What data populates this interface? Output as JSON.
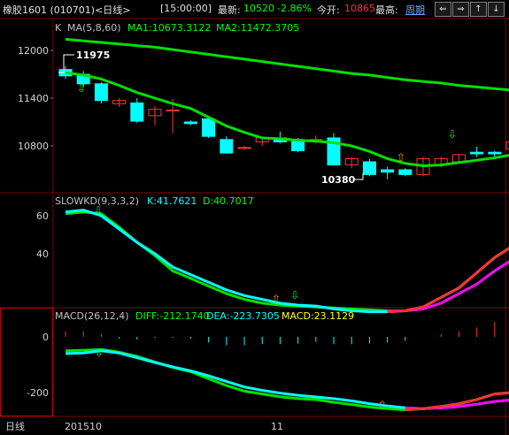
{
  "header": {
    "instrument": "橡胶1601 (010701)<日线>",
    "time": "[15:00:00]",
    "last_label": "最新:",
    "last_value": "10520",
    "change": "-2.86%",
    "open_label": "今开:",
    "open_value": "10865",
    "high_label": "最高:",
    "period_link": "周期",
    "nav_icons": [
      "prev-icon",
      "next-icon",
      "zoom-in-icon",
      "zoom-out-icon"
    ]
  },
  "price_panel": {
    "title_k": "K",
    "ma_label": "MA(5,8,60)",
    "ma1_text": "MA1:10673.3122",
    "ma2_text": "MA2:11472.3705",
    "y_ticks": [
      "12000",
      "11400",
      "10800"
    ],
    "high_annotation": "11975",
    "low_annotation": "10380"
  },
  "kd_panel": {
    "title": "SLOWKD(9,3,3,2)",
    "k_text": "K:41.7621",
    "d_text": "D:40.7017",
    "y_ticks": [
      "60",
      "40"
    ]
  },
  "macd_panel": {
    "title": "MACD(26,12,4)",
    "diff_text": "DIFF:-212.1740",
    "dea_text": "DEA:-223.7305",
    "macd_text": "MACD:23.1129",
    "y_ticks": [
      "0",
      "-200"
    ]
  },
  "footer": {
    "period": "日线",
    "date_start": "201510",
    "month_mark": "11"
  },
  "colors": {
    "up": "#ff3232",
    "down": "#00ffff",
    "ma1": "#00e000",
    "ma2": "#00e000",
    "frame": "#800000",
    "k_line": "#00ffff",
    "d_line": "#00e000",
    "label_yellow": "#ffff00",
    "label_green": "#00ff00",
    "label_magenta": "#ff00ff"
  },
  "chart_data": {
    "type": "candlestick",
    "candles": [
      {
        "o": 11760,
        "h": 11800,
        "l": 11640,
        "c": 11680
      },
      {
        "o": 11700,
        "h": 11740,
        "l": 11540,
        "c": 11580
      },
      {
        "o": 11580,
        "h": 11600,
        "l": 11330,
        "c": 11370
      },
      {
        "o": 11330,
        "h": 11400,
        "l": 11290,
        "c": 11370
      },
      {
        "o": 11340,
        "h": 11400,
        "l": 11090,
        "c": 11110
      },
      {
        "o": 11180,
        "h": 11300,
        "l": 11060,
        "c": 11260
      },
      {
        "o": 11250,
        "h": 11390,
        "l": 10960,
        "c": 11250
      },
      {
        "o": 11100,
        "h": 11120,
        "l": 11060,
        "c": 11080
      },
      {
        "o": 11140,
        "h": 11180,
        "l": 10900,
        "c": 10920
      },
      {
        "o": 10880,
        "h": 10920,
        "l": 10700,
        "c": 10710
      },
      {
        "o": 10780,
        "h": 10800,
        "l": 10750,
        "c": 10780
      },
      {
        "o": 10850,
        "h": 10920,
        "l": 10800,
        "c": 10900
      },
      {
        "o": 10900,
        "h": 10980,
        "l": 10830,
        "c": 10850
      },
      {
        "o": 10880,
        "h": 10900,
        "l": 10720,
        "c": 10740
      },
      {
        "o": 10860,
        "h": 10930,
        "l": 10830,
        "c": 10880
      },
      {
        "o": 10900,
        "h": 10960,
        "l": 10550,
        "c": 10560
      },
      {
        "o": 10560,
        "h": 10660,
        "l": 10520,
        "c": 10640
      },
      {
        "o": 10600,
        "h": 10640,
        "l": 10420,
        "c": 10440
      },
      {
        "o": 10500,
        "h": 10540,
        "l": 10380,
        "c": 10470
      },
      {
        "o": 10500,
        "h": 10520,
        "l": 10420,
        "c": 10440
      },
      {
        "o": 10440,
        "h": 10660,
        "l": 10420,
        "c": 10640
      },
      {
        "o": 10560,
        "h": 10660,
        "l": 10530,
        "c": 10640
      },
      {
        "o": 10600,
        "h": 10700,
        "l": 10580,
        "c": 10690
      },
      {
        "o": 10720,
        "h": 10790,
        "l": 10660,
        "c": 10700
      },
      {
        "o": 10720,
        "h": 10740,
        "l": 10660,
        "c": 10700
      },
      {
        "o": 10760,
        "h": 10870,
        "l": 10740,
        "c": 10850
      },
      {
        "o": 10880,
        "h": 10900,
        "l": 10480,
        "c": 10520
      }
    ],
    "ma1": [
      11720,
      11690,
      11640,
      11560,
      11470,
      11400,
      11330,
      11270,
      11160,
      11050,
      10970,
      10900,
      10890,
      10870,
      10860,
      10840,
      10800,
      10730,
      10640,
      10580,
      10550,
      10560,
      10590,
      10620,
      10650,
      10690,
      10670
    ],
    "ma2": [
      12140,
      12120,
      12100,
      12080,
      12060,
      12040,
      12010,
      11980,
      11950,
      11920,
      11890,
      11860,
      11830,
      11800,
      11770,
      11740,
      11710,
      11690,
      11660,
      11630,
      11610,
      11590,
      11560,
      11540,
      11520,
      11500,
      11470
    ],
    "price_range": [
      10320,
      12140
    ],
    "slowkd_k": [
      62,
      63,
      60,
      53,
      46,
      40,
      33,
      29,
      25,
      21,
      18,
      16,
      14,
      13,
      12.5,
      11,
      10,
      9.5,
      9.5,
      10,
      12,
      17,
      22,
      30,
      38,
      44,
      41.8
    ],
    "slowkd_d": [
      61,
      62,
      61,
      54,
      46,
      39,
      31,
      27,
      23,
      19,
      16,
      14,
      13,
      12.5,
      12,
      11.5,
      11,
      10.5,
      10,
      10,
      11,
      14,
      19,
      24,
      31,
      37,
      40.7
    ],
    "kd_range": [
      5,
      68
    ],
    "diff": [
      -50,
      -48,
      -45,
      -55,
      -70,
      -90,
      -110,
      -125,
      -150,
      -175,
      -195,
      -205,
      -215,
      -222,
      -225,
      -235,
      -243,
      -252,
      -258,
      -262,
      -258,
      -250,
      -240,
      -225,
      -205,
      -200,
      -212
    ],
    "dea": [
      -60,
      -58,
      -50,
      -58,
      -75,
      -92,
      -108,
      -122,
      -140,
      -160,
      -180,
      -192,
      -202,
      -210,
      -216,
      -222,
      -230,
      -240,
      -248,
      -255,
      -258,
      -255,
      -250,
      -242,
      -232,
      -226,
      -224
    ],
    "macd_bars": [
      20,
      20,
      10,
      -6,
      -10,
      -4,
      -4,
      -6,
      -20,
      -30,
      -30,
      -26,
      -26,
      -24,
      -18,
      -26,
      -26,
      -24,
      -20,
      -14,
      0,
      10,
      20,
      34,
      54,
      50,
      23
    ],
    "macd_range": [
      -290,
      40
    ]
  }
}
